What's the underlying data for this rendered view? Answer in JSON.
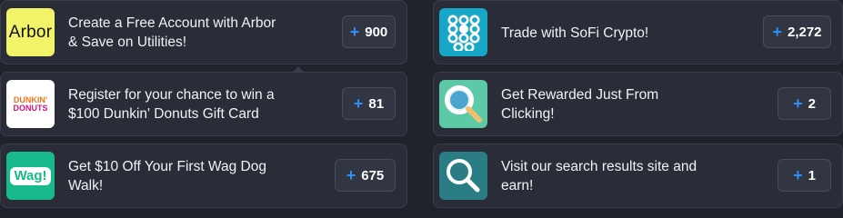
{
  "colors": {
    "accent_plus": "#2f8ef5",
    "card_bg": "#2a2d37",
    "page_bg": "#20232c"
  },
  "offers": [
    {
      "logo_text": "Arbor",
      "title_line1": "Create a Free Account with Arbor",
      "title_line2": "& Save on Utilities!",
      "points": "900",
      "icon": "arbor-logo"
    },
    {
      "logo_text": "",
      "title_line1": "Trade with SoFi Crypto!",
      "title_line2": "",
      "points": "2,272",
      "icon": "sofi-dots-logo"
    },
    {
      "logo_text_top": "DUNKIN'",
      "logo_text_bottom": "DONUTS",
      "title_line1": "Register for your chance to win a",
      "title_line2": "$100 Dunkin' Donuts Gift Card",
      "points": "81",
      "icon": "dunkin-logo"
    },
    {
      "logo_text": "",
      "title_line1": "Get Rewarded Just From",
      "title_line2": "Clicking!",
      "points": "2",
      "icon": "magnifier-logo"
    },
    {
      "logo_text": "Wag!",
      "title_line1": "Get $10 Off Your First Wag Dog",
      "title_line2": "Walk!",
      "points": "675",
      "icon": "wag-logo"
    },
    {
      "logo_text": "",
      "title_line1": "Visit our search results site and",
      "title_line2": "earn!",
      "points": "1",
      "icon": "search-logo"
    }
  ],
  "plus_symbol": "+"
}
